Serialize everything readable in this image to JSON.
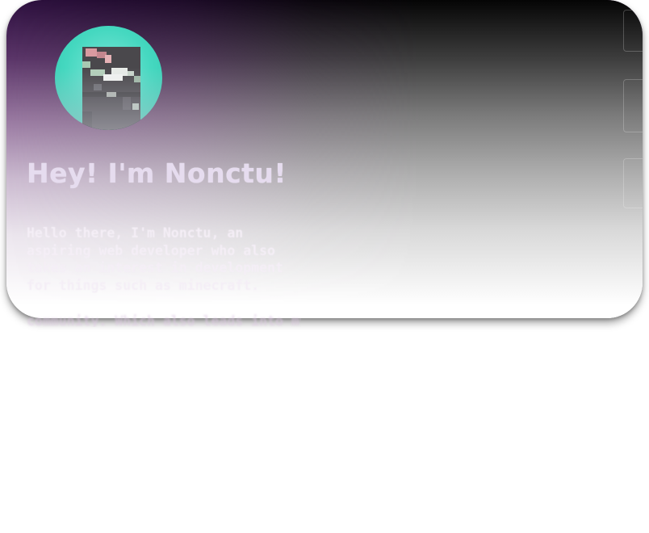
{
  "profile": {
    "avatar_icon": "pixel-skin-avatar",
    "avatar_bg": "#45d8c0",
    "headline": "Hey! I'm Nonctu!",
    "intro_text": "Hello there, I'm Nonctu, an aspiring web developer who also takes an interest in development for things such as minecraft.",
    "overflow_text": "community. Which also leads into my"
  },
  "colors": {
    "headline": "#e6dcef",
    "text": "#f4eef6",
    "gradient_top_left": "#2e1040",
    "gradient_top_right": "#050505"
  }
}
